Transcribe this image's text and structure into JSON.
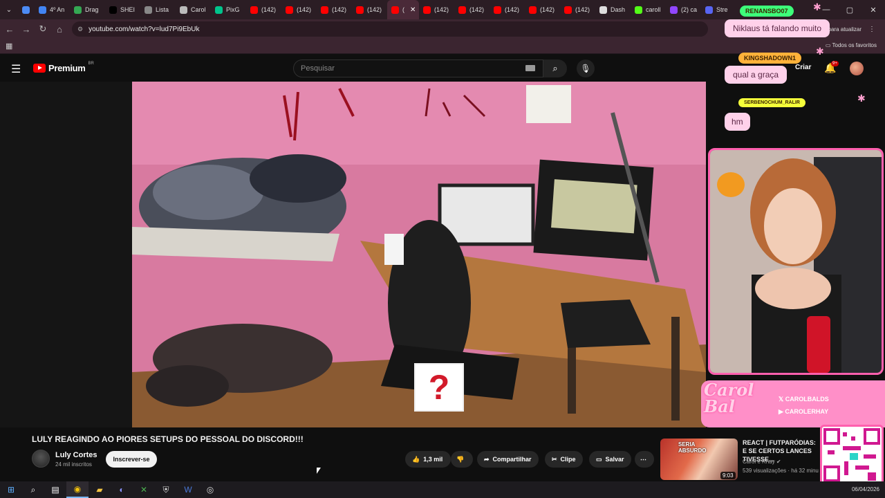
{
  "browser": {
    "tabs": [
      {
        "label": "",
        "color": "#4c8bf5"
      },
      {
        "label": "4º An",
        "color": "#4285f4"
      },
      {
        "label": "Drag",
        "color": "#34a853"
      },
      {
        "label": "SHEI",
        "color": "#000000"
      },
      {
        "label": "Lista",
        "color": "#888888"
      },
      {
        "label": "Carol",
        "color": "#bbbbbb"
      },
      {
        "label": "PixG",
        "color": "#00c48c"
      },
      {
        "label": "(142)",
        "color": "#ff0000"
      },
      {
        "label": "(142)",
        "color": "#ff0000"
      },
      {
        "label": "(142)",
        "color": "#ff0000"
      },
      {
        "label": "(142)",
        "color": "#ff0000"
      },
      {
        "label": "(",
        "color": "#ff0000",
        "active": true
      },
      {
        "label": "(142)",
        "color": "#ff0000"
      },
      {
        "label": "(142)",
        "color": "#ff0000"
      },
      {
        "label": "(142)",
        "color": "#ff0000"
      },
      {
        "label": "(142)",
        "color": "#ff0000"
      },
      {
        "label": "(142)",
        "color": "#ff0000"
      },
      {
        "label": "Dash",
        "color": "#dddddd"
      },
      {
        "label": "caroll",
        "color": "#53fc18"
      },
      {
        "label": "(2) ca",
        "color": "#9146ff"
      },
      {
        "label": "Stre",
        "color": "#5865f2"
      }
    ],
    "url": "youtube.com/watch?v=lud7Pi9EbUk",
    "update_label": "para atualizar",
    "all_favorites": "Todos os favoritos"
  },
  "youtube": {
    "logo": "Premium",
    "region": "BR",
    "search_placeholder": "Pesquisar",
    "create_label": "Criar",
    "notif_badge": "9+"
  },
  "video": {
    "title": "LULY REAGINDO AO PIORES SETUPS DO PESSOAL DO DISCORD!!!",
    "channel": "Luly Cortes",
    "subscribers": "24 mil inscritos",
    "subscribe_label": "Inscrever-se",
    "likes": "1,3 mil",
    "share_label": "Compartilhar",
    "clip_label": "Clipe",
    "save_label": "Salvar",
    "overlay_glyph": "?"
  },
  "recommendation": {
    "thumb_text": "SERIA\nABSURDO",
    "title": "REACT | FUTPARÓDIAS: E SE CERTOS LANCES TIVESSE...",
    "channel": "Carol e Rhay",
    "meta": "539 visualizações · há 32 minu",
    "duration": "9:03"
  },
  "chat": [
    {
      "user": "RENANSBO07",
      "message": "Niklaus tá falando muito",
      "user_color": "#3dff7a"
    },
    {
      "user": "KINGSHADOWN1",
      "message": "qual a graça",
      "user_color": "#ffb23a"
    },
    {
      "user": "SERBENOCHUM_RALIR",
      "message": "hm",
      "user_color": "#f5ff3a"
    }
  ],
  "overlay": {
    "brand": "Carol Bal",
    "social_x": "CAROLBALDS",
    "social_yt": "CAROLERHAY"
  },
  "taskbar": {
    "date": "06/04/2026",
    "apps": [
      "start-icon",
      "search-icon",
      "task-view-icon",
      "chrome-icon",
      "explorer-icon",
      "discord-icon",
      "xbox-icon",
      "vpn-icon",
      "word-icon",
      "obs-icon"
    ]
  }
}
